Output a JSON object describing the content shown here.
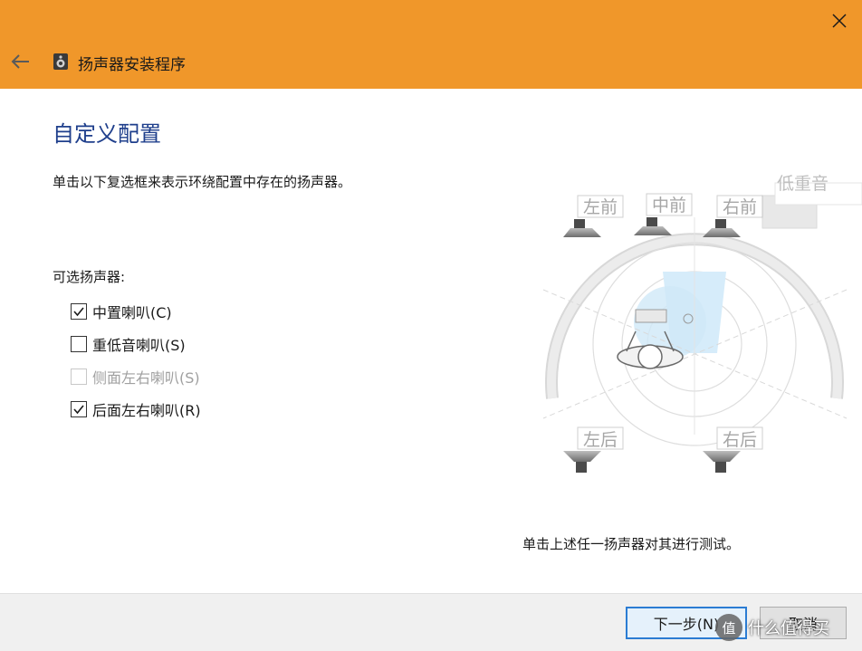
{
  "window": {
    "title": "扬声器安装程序",
    "accent_color": "#f0972a",
    "icons": {
      "back": "back-arrow-icon",
      "close": "close-icon",
      "app": "speaker-icon"
    }
  },
  "page": {
    "title": "自定义配置",
    "instruction": "单击以下复选框来表示环绕配置中存在的扬声器。",
    "optional_label": "可选扬声器:"
  },
  "options": [
    {
      "label": "中置喇叭(C)",
      "checked": true,
      "enabled": true
    },
    {
      "label": "重低音喇叭(S)",
      "checked": false,
      "enabled": true
    },
    {
      "label": "侧面左右喇叭(S)",
      "checked": false,
      "enabled": false
    },
    {
      "label": "后面左右喇叭(R)",
      "checked": true,
      "enabled": true
    }
  ],
  "speakers": {
    "front_left": "左前",
    "front_center": "中前",
    "front_right": "右前",
    "subwoofer": "低重音",
    "rear_left": "左后",
    "rear_right": "右后"
  },
  "test_hint": "单击上述任一扬声器对其进行测试。",
  "footer": {
    "next_label": "下一步(N)",
    "cancel_label": "取消"
  },
  "watermark": {
    "badge": "值",
    "text": "什么值得买"
  }
}
